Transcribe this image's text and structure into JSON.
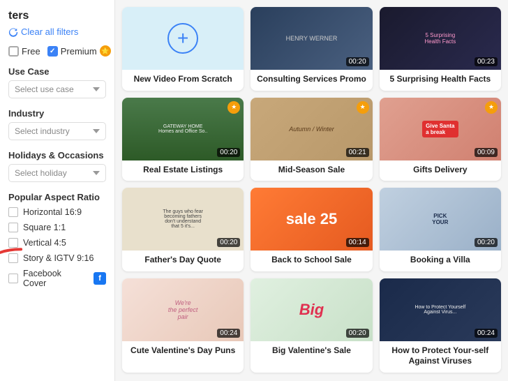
{
  "sidebar": {
    "title": "ters",
    "clear_filters_label": "Clear all filters",
    "price": {
      "free_label": "Free",
      "premium_label": "Premium",
      "free_checked": false,
      "premium_checked": true
    },
    "use_case": {
      "label": "Use Case",
      "placeholder": "Select use case"
    },
    "industry": {
      "label": "Industry",
      "placeholder": "Select industry"
    },
    "holidays": {
      "label": "Holidays & Occasions",
      "placeholder": "Select holiday"
    },
    "aspect": {
      "label": "Popular Aspect Ratio",
      "options": [
        {
          "id": "h169",
          "label": "Horizontal 16:9"
        },
        {
          "id": "s11",
          "label": "Square 1:1"
        },
        {
          "id": "v45",
          "label": "Vertical 4:5"
        },
        {
          "id": "s916",
          "label": "Story & IGTV 9:16"
        },
        {
          "id": "fb",
          "label": "Facebook Cover"
        }
      ]
    }
  },
  "grid": {
    "cards": [
      {
        "id": "new",
        "type": "new",
        "title": "New Video From Scratch",
        "thumb_color": "light-blue",
        "duration": null,
        "premium": false
      },
      {
        "id": "consulting",
        "type": "normal",
        "title": "Consulting Services Promo",
        "thumb_color": "dark-overlay",
        "duration": "00:20",
        "premium": false
      },
      {
        "id": "health",
        "type": "normal",
        "title": "5 Surprising Health Facts",
        "thumb_color": "dark-overlay",
        "duration": "00:23",
        "premium": false
      },
      {
        "id": "realestate",
        "type": "normal",
        "title": "Real Estate Listings",
        "thumb_color": "dark-green",
        "duration": "00:20",
        "premium": true
      },
      {
        "id": "midseason",
        "type": "normal",
        "title": "Mid-Season Sale",
        "thumb_color": "autumn",
        "duration": "00:21",
        "premium": true
      },
      {
        "id": "gifts",
        "type": "normal",
        "title": "Gifts Delivery",
        "thumb_color": "xmas",
        "duration": "00:09",
        "premium": true
      },
      {
        "id": "fathers",
        "type": "normal",
        "title": "Father's Day Quote",
        "thumb_color": "kids",
        "duration": "00:20",
        "premium": false
      },
      {
        "id": "backtoschool",
        "type": "normal",
        "title": "Back to School Sale",
        "thumb_color": "sale",
        "duration": "00:14",
        "premium": false
      },
      {
        "id": "villa",
        "type": "normal",
        "title": "Booking a Villa",
        "thumb_color": "villa",
        "duration": "00:20",
        "premium": false
      },
      {
        "id": "valentines_cute",
        "type": "normal",
        "title": "Cute Valentine's Day Puns",
        "thumb_color": "pink",
        "duration": "00:24",
        "premium": false
      },
      {
        "id": "valentines_big",
        "type": "normal",
        "title": "Big Valentine's Sale",
        "thumb_color": "big",
        "duration": "00:20",
        "premium": false
      },
      {
        "id": "virus",
        "type": "normal",
        "title": "How to Protect Your-self Against Viruses",
        "thumb_color": "virus",
        "duration": "00:24",
        "premium": false
      }
    ]
  }
}
